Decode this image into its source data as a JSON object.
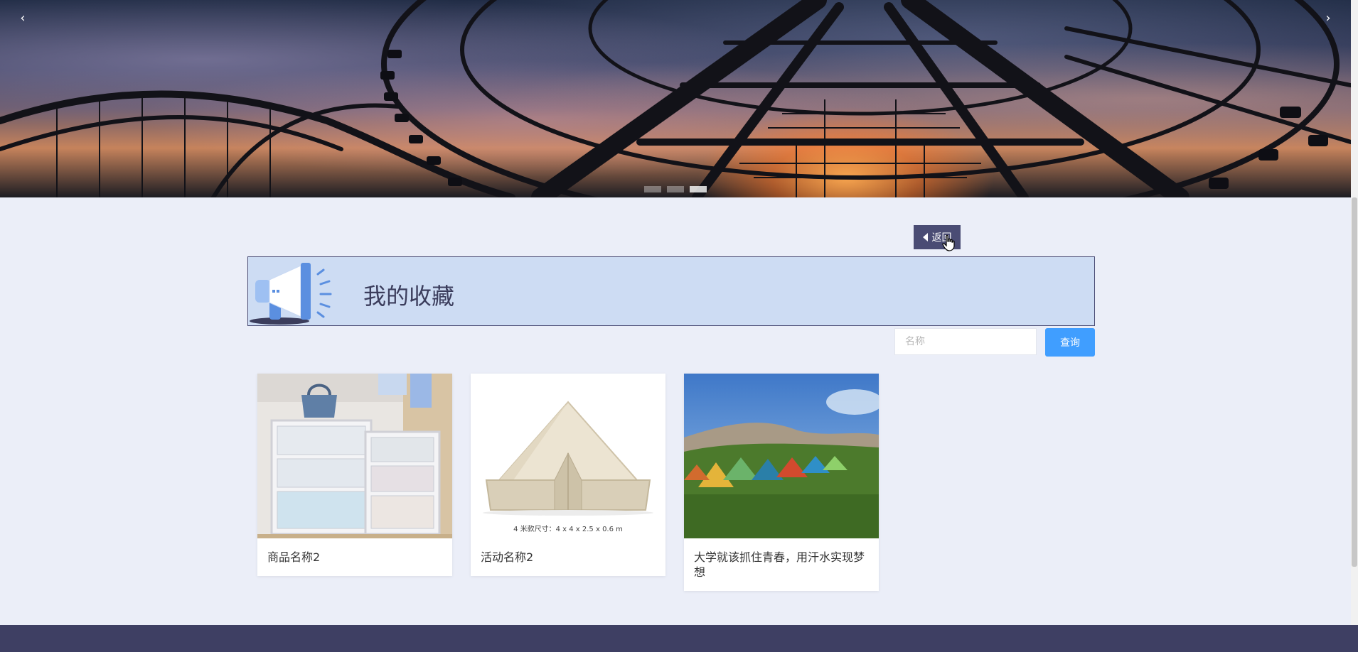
{
  "banner": {
    "prev_icon": "‹",
    "next_icon": "›",
    "slides": 3,
    "active_slide": 3
  },
  "nav": {
    "back_label": "返回"
  },
  "header": {
    "title": "我的收藏"
  },
  "search": {
    "placeholder": "名称",
    "button_label": "查询"
  },
  "favorites": [
    {
      "label": "商品名称2"
    },
    {
      "label": "活动名称2",
      "image_caption": "4 米款尺寸：4 x 4 x 2.5 x 0.6 m"
    },
    {
      "label": "大学就该抓住青春，用汗水实现梦想"
    }
  ],
  "colors": {
    "page_bg": "#ebeef8",
    "accent": "#4a4c74",
    "title_bg": "#cddcf3",
    "search_button": "#409eff",
    "footer": "#3e3f63"
  }
}
